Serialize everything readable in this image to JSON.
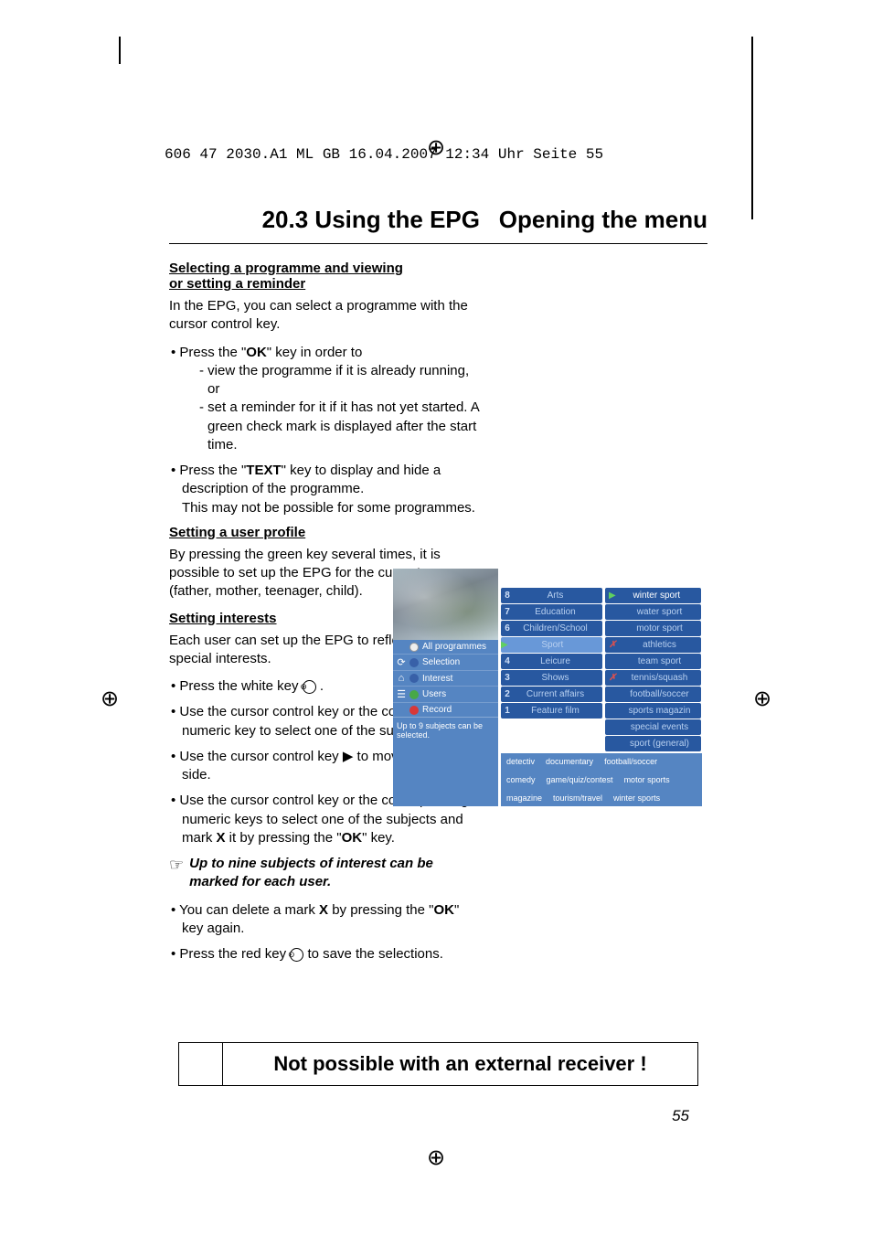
{
  "header_line": "606 47 2030.A1  ML GB  16.04.2007  12:34 Uhr  Seite 55",
  "title_left": "20.3 Using the EPG",
  "title_right": "Opening the menu",
  "section1_heading_l1": "Selecting a programme and viewing",
  "section1_heading_l2": "or setting a reminder",
  "p1": "In the EPG, you can select a programme with the cursor control key.",
  "b1_intro": "• Press the \"",
  "b1_ok": "OK",
  "b1_cont": "\" key in order to",
  "b1_sub1": "- view the programme if it is already running, or",
  "b1_sub2": "- set a reminder for it if it has not yet started. A green check mark is displayed after the start time.",
  "b2_intro": "• Press the \"",
  "b2_text": "TEXT",
  "b2_cont1": "\" key to display and hide a description of the programme.",
  "b2_cont2": "This may not be possible for some programmes.",
  "section2_heading": "Setting a user profile",
  "p2": "By pressing the green key several times, it is possible to set up the EPG for the current user (father, mother, teenager, child).",
  "section3_heading": "Setting interests",
  "p3": "Each user can set up the EPG to reflect his or her special interests.",
  "b3a": "• Press the white key ",
  "b3b": "• Use the cursor control key or the corresponding numeric key to select one of the subjects.",
  "b3c_intro": "• Use the cursor control key ",
  "b3c_cont": " to move to the other side.",
  "b4_intro": "• Use the cursor control key or the corresponding numeric keys to select one of the subjects and mark ",
  "b4_x": "X",
  "b4_cont": " it by pressing the \"",
  "b4_ok": "OK",
  "b4_end": "\" key.",
  "pointer_text": "Up to nine subjects of interest can be marked for each user.",
  "b5_intro": "• You can delete a mark ",
  "b5_x": "X",
  "b5_cont": " by pressing the \"",
  "b5_ok": "OK",
  "b5_end": "\" key again.",
  "b6_intro": "• Press the red key ",
  "b6_cont": " to save the selections.",
  "banner_text": "Not possible with an external receiver !",
  "page_number": "55",
  "screenshot": {
    "left_menu": [
      {
        "label": "All programmes",
        "dot": "white",
        "icon": ""
      },
      {
        "label": "Selection",
        "dot": "blue",
        "icon": "⟳"
      },
      {
        "label": "Interest",
        "dot": "blue",
        "icon": "⌂"
      },
      {
        "label": "Users",
        "dot": "green",
        "icon": "☰"
      },
      {
        "label": "Record",
        "dot": "red",
        "icon": ""
      }
    ],
    "selection_note": "Up to 9 subjects can be selected.",
    "mid_items": [
      {
        "num": "8",
        "label": "Arts"
      },
      {
        "num": "7",
        "label": "Education"
      },
      {
        "num": "6",
        "label": "Children/School"
      },
      {
        "num": "",
        "label": "Sport"
      },
      {
        "num": "4",
        "label": "Leicure"
      },
      {
        "num": "3",
        "label": "Shows"
      },
      {
        "num": "2",
        "label": "Current affairs"
      },
      {
        "num": "1",
        "label": "Feature film"
      }
    ],
    "right_items": [
      {
        "mark": "",
        "label": "winter sport",
        "play": true
      },
      {
        "mark": "",
        "label": "water sport"
      },
      {
        "mark": "",
        "label": "motor sport"
      },
      {
        "mark": "✗",
        "label": "athletics"
      },
      {
        "mark": "",
        "label": "team sport"
      },
      {
        "mark": "✗",
        "label": "tennis/squash"
      },
      {
        "mark": "",
        "label": "football/soccer"
      },
      {
        "mark": "",
        "label": "sports magazin"
      },
      {
        "mark": "",
        "label": "special events"
      },
      {
        "mark": "",
        "label": "sport (general)"
      }
    ],
    "footer_words": [
      "detectiv",
      "documentary",
      "football/soccer",
      "comedy",
      "game/quiz/contest",
      "motor sports",
      "magazine",
      "tourism/travel",
      "winter sports"
    ]
  }
}
